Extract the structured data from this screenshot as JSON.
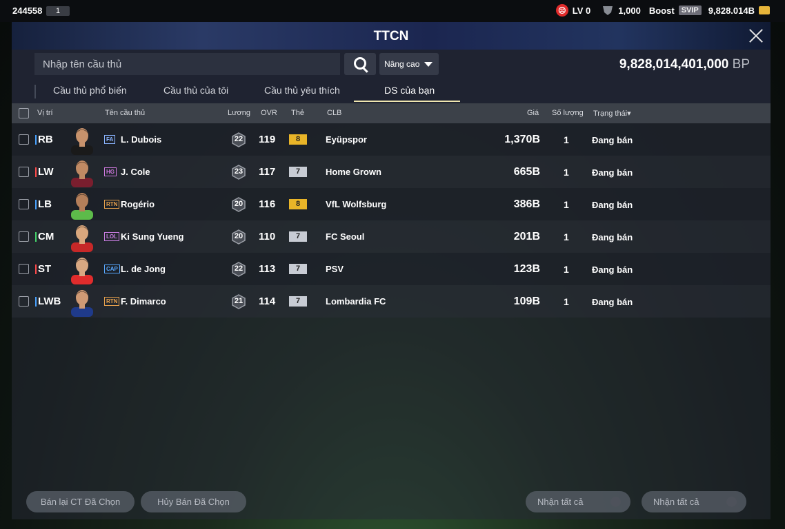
{
  "topbar": {
    "user_id": "244558",
    "user_badge": "1",
    "level": "LV 0",
    "shield_count": "1,000",
    "boost_label": "Boost",
    "svip_label": "SVIP",
    "currency": "9,828.014B"
  },
  "header": {
    "title": "TTCN"
  },
  "search": {
    "placeholder": "Nhập tên cầu thủ",
    "advanced_label": "Nâng cao",
    "bp_amount": "9,828,014,401,000",
    "bp_unit": "BP"
  },
  "tabs": [
    {
      "label": "Cầu thủ phổ biến"
    },
    {
      "label": "Cầu thủ của tôi"
    },
    {
      "label": "Cầu thủ yêu thích"
    },
    {
      "label": "DS của bạn"
    }
  ],
  "table": {
    "headers": {
      "position": "Vị trí",
      "name": "Tên cầu thủ",
      "salary": "Lương",
      "ovr": "OVR",
      "card": "Thẻ",
      "club": "CLB",
      "price": "Giá",
      "quantity": "Số lượng",
      "status": "Trạng thái▾"
    },
    "rows": [
      {
        "position": "RB",
        "position_color": "#4aa3ff",
        "season": "FA",
        "season_color": "#8ab4ff",
        "name": "L. Dubois",
        "salary": "22",
        "ovr": "119",
        "level": "8",
        "level_color": "#e9b528",
        "club": "Eyüpspor",
        "price": "1,370B",
        "quantity": "1",
        "status": "Đang bán",
        "face": "#c7926c",
        "shirt": "#1a1a1a"
      },
      {
        "position": "LW",
        "position_color": "#ff4a4a",
        "season": "HG",
        "season_color": "#d07ae0",
        "name": "J. Cole",
        "salary": "23",
        "ovr": "117",
        "level": "7",
        "level_color": "#c8ccd4",
        "club": "Home Grown",
        "price": "665B",
        "quantity": "1",
        "status": "Đang bán",
        "face": "#c08a64",
        "shirt": "#7a1e2e"
      },
      {
        "position": "LB",
        "position_color": "#4aa3ff",
        "season": "RTN",
        "season_color": "#e6a04c",
        "name": "Rogério",
        "salary": "20",
        "ovr": "116",
        "level": "8",
        "level_color": "#e9b528",
        "club": "VfL Wolfsburg",
        "price": "386B",
        "quantity": "1",
        "status": "Đang bán",
        "face": "#b57f5a",
        "shirt": "#5dbb4a"
      },
      {
        "position": "CM",
        "position_color": "#44d36a",
        "season": "LOL",
        "season_color": "#c77ce0",
        "name": "Ki Sung Yueng",
        "salary": "20",
        "ovr": "110",
        "level": "7",
        "level_color": "#c8ccd4",
        "club": "FC Seoul",
        "price": "201B",
        "quantity": "1",
        "status": "Đang bán",
        "face": "#d9a77d",
        "shirt": "#c62828"
      },
      {
        "position": "ST",
        "position_color": "#ff4a4a",
        "season": "CAP",
        "season_color": "#58a8ff",
        "name": "L. de Jong",
        "salary": "22",
        "ovr": "113",
        "level": "7",
        "level_color": "#c8ccd4",
        "club": "PSV",
        "price": "123B",
        "quantity": "1",
        "status": "Đang bán",
        "face": "#d8a882",
        "shirt": "#e02c2c"
      },
      {
        "position": "LWB",
        "position_color": "#4aa3ff",
        "season": "RTN",
        "season_color": "#e6a04c",
        "name": "F. Dimarco",
        "salary": "21",
        "ovr": "114",
        "level": "7",
        "level_color": "#c8ccd4",
        "club": "Lombardia FC",
        "price": "109B",
        "quantity": "1",
        "status": "Đang bán",
        "face": "#cf9a75",
        "shirt": "#1f3a8a"
      }
    ]
  },
  "bottom": {
    "resell_label": "Bán lại CT Đã Chọn",
    "cancel_label": "Hủy Bán Đã Chọn",
    "claim_all_label_1": "Nhận tất cả",
    "claim_all_label_2": "Nhận tất cả"
  }
}
